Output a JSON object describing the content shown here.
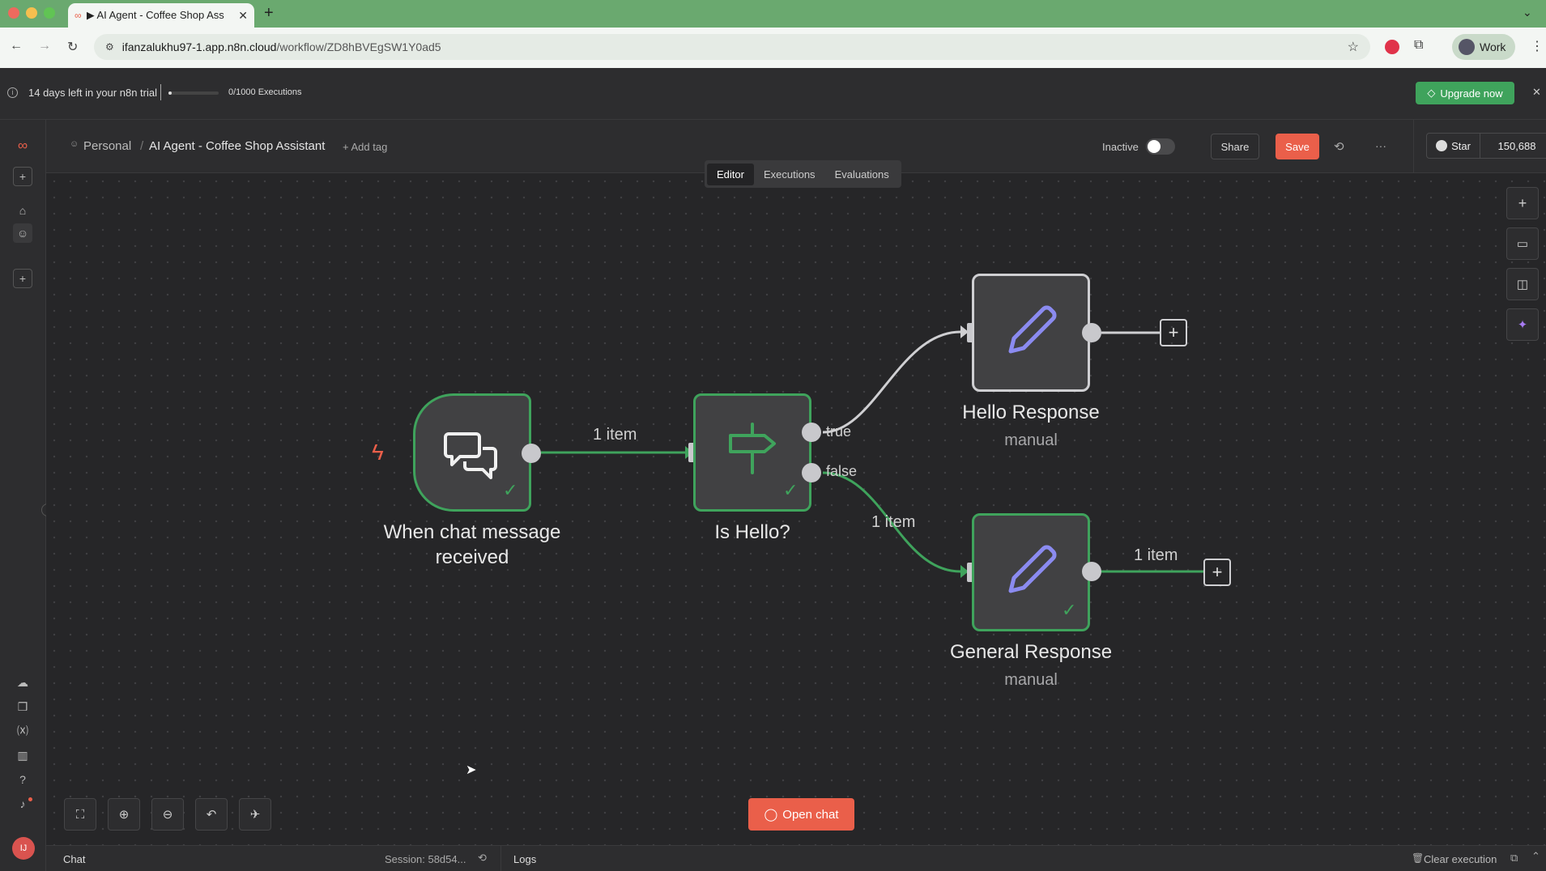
{
  "browser": {
    "tab_title": "▶ AI Agent - Coffee Shop Ass",
    "url_host": "ifanzalukhu97-1.app.n8n.cloud",
    "url_path": "/workflow/ZD8hBVEgSW1Y0ad5",
    "profile_label": "Work"
  },
  "trial": {
    "days_left": "14 days left in your n8n trial",
    "executions": "0/1000 Executions",
    "upgrade_label": "Upgrade now"
  },
  "header": {
    "project": "Personal",
    "separator": "/",
    "workflow_name": "AI Agent - Coffee Shop Assistant",
    "add_tag": "+ Add tag",
    "status": "Inactive",
    "share_label": "Share",
    "save_label": "Save",
    "more_label": "···",
    "star_label": "Star",
    "star_count": "150,688"
  },
  "mode_tabs": [
    "Editor",
    "Executions",
    "Evaluations"
  ],
  "nodes": {
    "trigger": {
      "label_line1": "When chat message",
      "label_line2": "received"
    },
    "if": {
      "label": "Is Hello?"
    },
    "hello": {
      "label": "Hello Response",
      "sub": "manual"
    },
    "general": {
      "label": "General Response",
      "sub": "manual"
    }
  },
  "edges": {
    "trigger_to_if": "1 item",
    "true_label": "true",
    "false_label": "false",
    "false_count": "1 item",
    "general_out": "1 item"
  },
  "canvas": {
    "open_chat_label": "Open chat"
  },
  "bottom": {
    "chat_label": "Chat",
    "session": "Session: 58d54...",
    "logs_label": "Logs",
    "clear_label": "Clear execution"
  },
  "colors": {
    "success": "#3fa35c",
    "accent": "#ea5f4a",
    "pencil": "#8b8bf0"
  }
}
